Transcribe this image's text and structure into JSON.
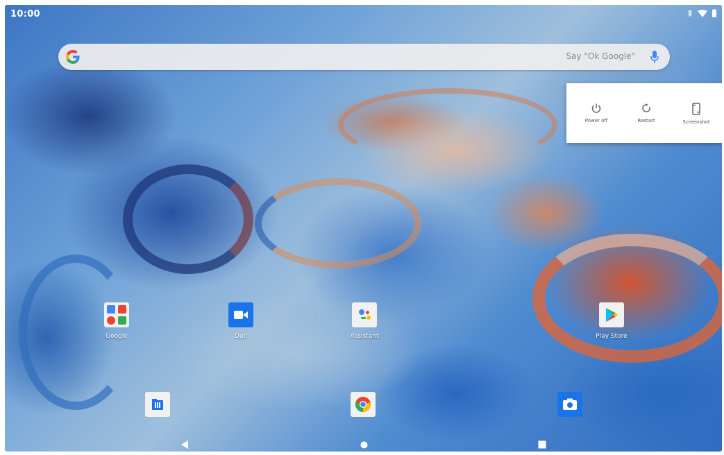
{
  "status_bar": {
    "time": "10:00",
    "icons": [
      "bluetooth-icon",
      "wifi-icon",
      "battery-icon"
    ]
  },
  "search_bar": {
    "logo": "G",
    "hint": "Say \"Ok Google\"",
    "mic_icon": "mic-icon"
  },
  "power_menu": {
    "items": [
      {
        "label": "Power off",
        "icon": "power-icon"
      },
      {
        "label": "Restart",
        "icon": "restart-icon"
      },
      {
        "label": "Screenshot",
        "icon": "screenshot-icon"
      }
    ]
  },
  "home_apps": [
    {
      "label": "Google",
      "icon": "google-folder-icon"
    },
    {
      "label": "Duo",
      "icon": "duo-icon"
    },
    {
      "label": "Assistant",
      "icon": "assistant-icon"
    },
    {
      "label": "Play Store",
      "icon": "play-store-icon"
    }
  ],
  "dock": [
    {
      "name": "files",
      "icon": "files-icon"
    },
    {
      "name": "chrome",
      "icon": "chrome-icon"
    },
    {
      "name": "camera",
      "icon": "camera-icon"
    }
  ],
  "nav_bar": {
    "buttons": [
      "back-button",
      "home-button",
      "recents-button"
    ]
  },
  "colors": {
    "google_blue": "#4285F4",
    "google_red": "#EA4335",
    "google_yellow": "#FBBC05",
    "google_green": "#34A853",
    "menu_bg": "#FFFFFF"
  }
}
